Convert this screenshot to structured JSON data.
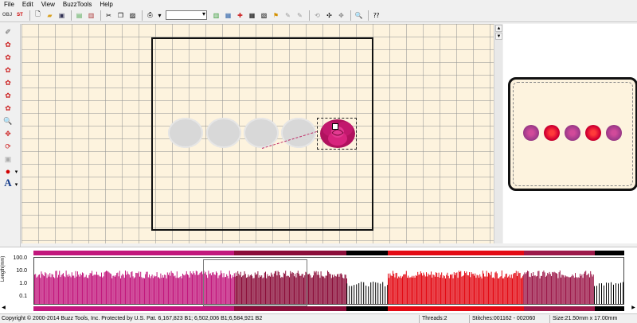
{
  "menu": [
    "File",
    "Edit",
    "View",
    "BuzzTools",
    "Help"
  ],
  "toolbar": {
    "obj_label": "OBJ",
    "st_label": "ST",
    "combo_value": ""
  },
  "colors": {
    "fabric": "#fdf3de",
    "rose_magenta": "#c2185b",
    "rose_red": "#d50032",
    "rose_purple": "#a23b8c",
    "ghost_gray": "#d8d8d8"
  },
  "graph": {
    "y_label": "Length(mm)",
    "y_ticks": [
      "100.0",
      "10.0",
      "1.0",
      "0.1"
    ],
    "color_segments": [
      {
        "color": "#c2187d",
        "fraction": 0.34
      },
      {
        "color": "#8b0e3a",
        "fraction": 0.19
      },
      {
        "color": "#000000",
        "fraction": 0.07
      },
      {
        "color": "#e30a14",
        "fraction": 0.23
      },
      {
        "color": "#9c1a4a",
        "fraction": 0.12
      },
      {
        "color": "#000000",
        "fraction": 0.05
      }
    ]
  },
  "status": {
    "copyright": "Copyright © 2000-2014 Buzz Tools, Inc. Protected by U.S. Pat. 6,167,823 B1; 6,502,006 B1;6,584,921 B2",
    "threads": "Threads:2",
    "stitches": "Stitches:001162 - 002060",
    "size": "Size:21.50mm x 17.00mm"
  }
}
